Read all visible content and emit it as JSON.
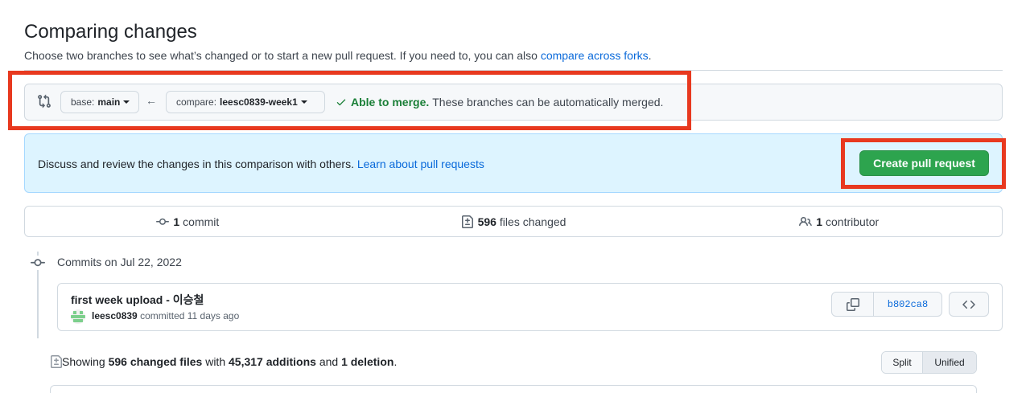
{
  "header": {
    "title": "Comparing changes",
    "subtitle_prefix": "Choose two branches to see what’s changed or to start a new pull request. If you need to, you can also ",
    "subtitle_link": "compare across forks",
    "subtitle_suffix": "."
  },
  "range": {
    "base_label": "base:",
    "base_value": "main",
    "compare_label": "compare:",
    "compare_value": "leesc0839-week1",
    "arrow": "←",
    "merge_ok": "Able to merge.",
    "merge_text": "These branches can be automatically merged."
  },
  "flash": {
    "text": "Discuss and review the changes in this comparison with others. ",
    "link": "Learn about pull requests",
    "button": "Create pull request"
  },
  "summary": {
    "commits_count": "1",
    "commits_label": "commit",
    "files_count": "596",
    "files_label": "files changed",
    "contributors_count": "1",
    "contributors_label": "contributor"
  },
  "commits": {
    "date_heading": "Commits on Jul 22, 2022",
    "items": [
      {
        "title": "first week upload - 이승철",
        "author": "leesc0839",
        "action": " committed 11 days ago",
        "sha": "b802ca8"
      }
    ]
  },
  "diff_summary": {
    "prefix": "Showing ",
    "files": "596 changed files",
    "mid1": " with ",
    "additions": "45,317 additions",
    "mid2": " and ",
    "deletions": "1 deletion",
    "suffix": "."
  },
  "view_toggle": {
    "split": "Split",
    "unified": "Unified"
  },
  "colors": {
    "accent_link": "#0969da",
    "success": "#1a7f37",
    "primary_button": "#2da44e",
    "annotation_red": "#e8391f",
    "flash_bg": "#ddf4ff"
  }
}
